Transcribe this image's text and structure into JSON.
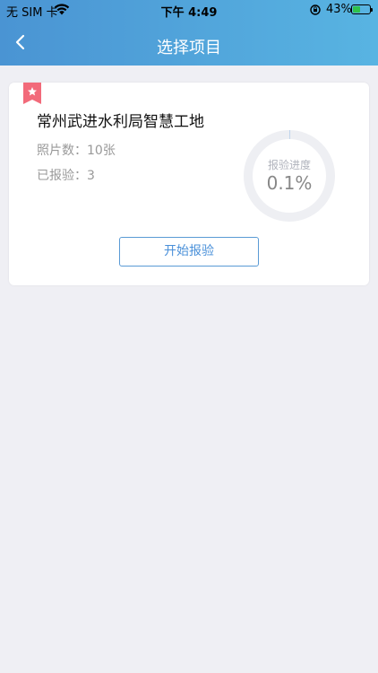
{
  "status_bar": {
    "carrier": "无 SIM 卡",
    "time": "下午 4:49",
    "battery": "43%",
    "battery_level": 0.43
  },
  "nav": {
    "back_icon": "chevron-left-icon",
    "title": "选择项目"
  },
  "project": {
    "badge_icon": "star-ribbon-icon",
    "name": "常州武进水利局智慧工地",
    "photos": "照片数：10张",
    "checked": "已报验：3",
    "progress_label": "报验进度",
    "progress_value": "0.1%",
    "progress_fraction": 0.001,
    "button_label": "开始报验"
  },
  "colors": {
    "header_start": "#4a94d3",
    "header_end": "#58b4e2",
    "accent": "#4a90d9",
    "ribbon": "#f26a7a",
    "background": "#efeff4",
    "ring": "#eeeff3"
  }
}
